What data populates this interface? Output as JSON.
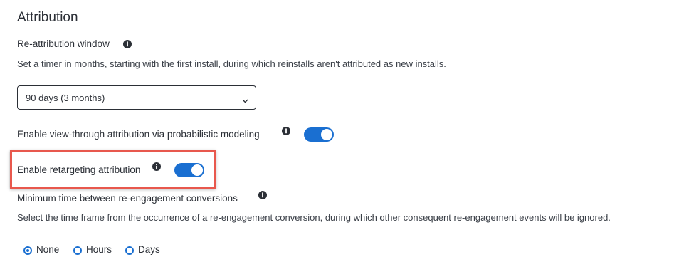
{
  "section": {
    "title": "Attribution"
  },
  "reattribution": {
    "label": "Re-attribution window",
    "description": "Set a timer in months, starting with the first install, during which reinstalls aren't attributed as new installs.",
    "selected_value": "90 days (3 months)"
  },
  "view_through": {
    "label": "Enable view-through attribution via probabilistic modeling",
    "enabled": true
  },
  "retargeting": {
    "label": "Enable retargeting attribution",
    "enabled": true
  },
  "reengagement": {
    "label": "Minimum time between re-engagement conversions",
    "description": "Select the time frame from the occurrence of a re-engagement conversion, during which other consequent re-engagement events will be ignored.",
    "options": [
      {
        "label": "None",
        "selected": true
      },
      {
        "label": "Hours",
        "selected": false
      },
      {
        "label": "Days",
        "selected": false
      }
    ]
  },
  "colors": {
    "accent": "#1a6fd1",
    "highlight": "#e8584d",
    "text": "#2b2f36"
  },
  "icons": {
    "info": "info-icon",
    "select_arrow": "chevron-down-icon"
  }
}
